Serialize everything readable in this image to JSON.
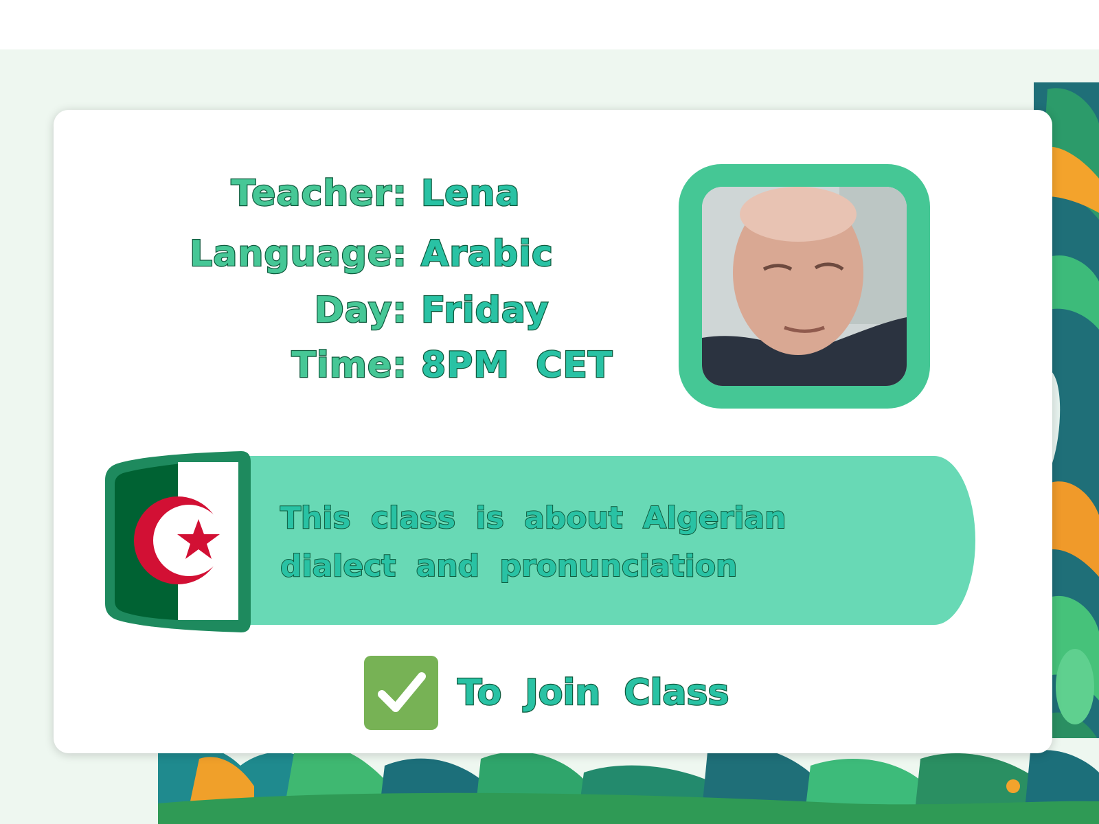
{
  "details": [
    {
      "label": "Teacher:",
      "value": "Lena"
    },
    {
      "label": "Language:",
      "value": "Arabic"
    },
    {
      "label": "Day:",
      "value": "Friday"
    },
    {
      "label": "Time:",
      "value": "8PM  CET"
    }
  ],
  "description": "This class is about Algerian dialect and pronunciation",
  "join_label": "To Join Class",
  "icons": {
    "flag": "algeria-flag-icon",
    "join": "check-mark-icon",
    "photo": "teacher-photo"
  },
  "colors": {
    "accent_green": "#45c795",
    "banner": "#68d9b5",
    "value_text": "#29c2a4",
    "label_text": "#46c796",
    "outline": "#0f5a3d",
    "check_box": "#77b255",
    "flag_green": "#006233",
    "flag_red": "#d21034"
  }
}
